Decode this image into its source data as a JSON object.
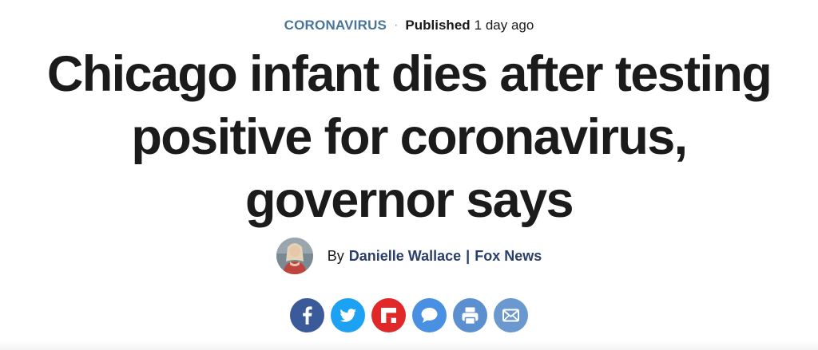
{
  "eyebrow": {
    "category": "CORONAVIRUS",
    "separator": "·",
    "published_label": "Published",
    "published_time": "1 day ago"
  },
  "headline": "Chicago infant dies after testing positive for coronavirus, governor says",
  "byline": {
    "prefix": "By",
    "author": "Danielle Wallace",
    "separator": "|",
    "outlet": "Fox News"
  },
  "share": {
    "buttons": [
      {
        "name": "facebook",
        "icon": "facebook-icon",
        "color": "#3b5a9a"
      },
      {
        "name": "twitter",
        "icon": "twitter-icon",
        "color": "#1da1f2"
      },
      {
        "name": "flipboard",
        "icon": "flipboard-icon",
        "color": "#e12828"
      },
      {
        "name": "comments",
        "icon": "comment-icon",
        "color": "#4a90e2"
      },
      {
        "name": "print",
        "icon": "print-icon",
        "color": "#5b8fd0"
      },
      {
        "name": "email",
        "icon": "email-icon",
        "color": "#6b99cf"
      }
    ]
  },
  "colors": {
    "category": "#4a7499",
    "author_link": "#2b3f6b",
    "headline": "#1b1b1b"
  }
}
